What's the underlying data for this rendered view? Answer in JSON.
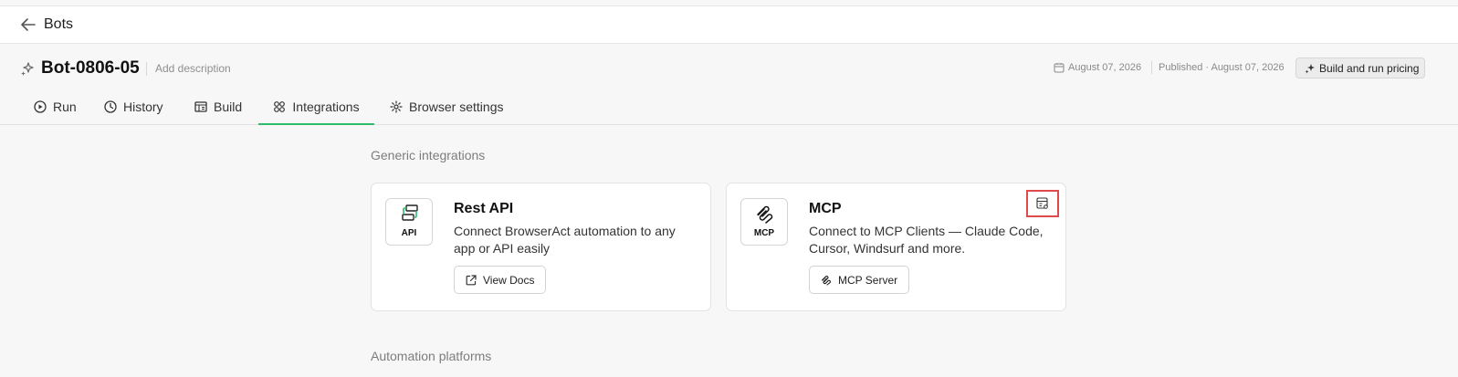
{
  "topbar": {
    "title": "Bots",
    "back_icon": "arrow-left-icon"
  },
  "bot": {
    "name": "Bot-0806-05",
    "add_description": "Add description",
    "icon": "sparkle-icon"
  },
  "meta": {
    "created": "August 07, 2026",
    "published": "Published · August 07, 2026",
    "pricing_button": "Build and run pricing"
  },
  "tabs": [
    {
      "label": "Run",
      "icon": "play-circle-icon"
    },
    {
      "label": "History",
      "icon": "clock-icon"
    },
    {
      "label": "Build",
      "icon": "layout-icon"
    },
    {
      "label": "Integrations",
      "icon": "integrations-icon",
      "active": true
    },
    {
      "label": "Browser settings",
      "icon": "gear-icon"
    }
  ],
  "sections": {
    "generic": "Generic integrations",
    "automation": "Automation platforms"
  },
  "cards": {
    "rest": {
      "logo_text": "API",
      "title": "Rest API",
      "description": "Connect BrowserAct automation to any app or API easily",
      "button": "View Docs"
    },
    "mcp": {
      "logo_text": "MCP",
      "title": "MCP",
      "description": "Connect to MCP Clients — Claude Code, Cursor, Windsurf and more.",
      "button": "MCP Server"
    }
  },
  "colors": {
    "accent": "#2dbd6e",
    "highlight": "#e04a4a",
    "background": "#f7f7f7"
  }
}
